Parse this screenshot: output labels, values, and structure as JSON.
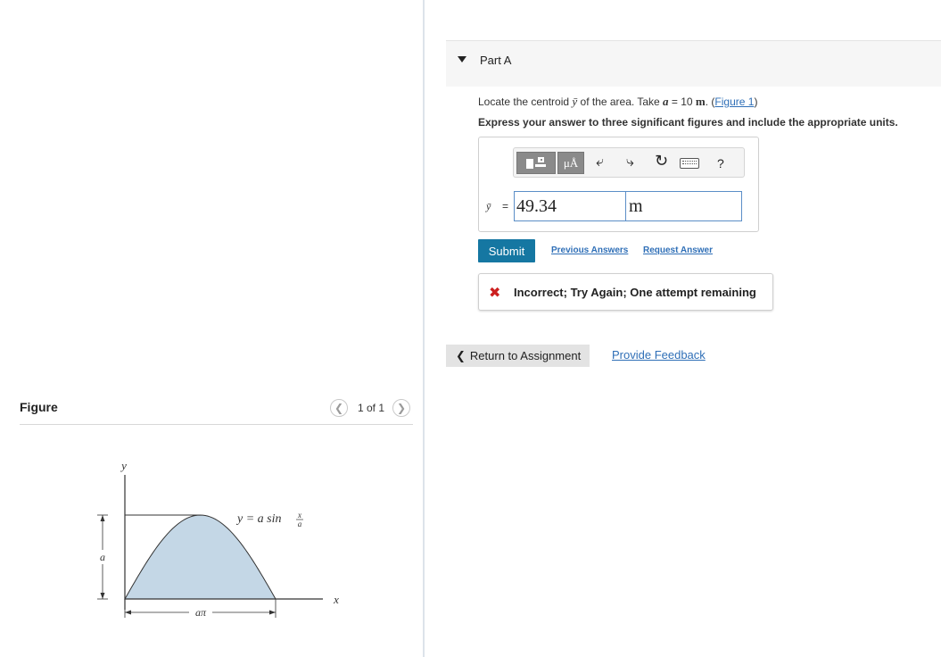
{
  "figure": {
    "title": "Figure",
    "pager": {
      "prev_icon": "chevron-left-icon",
      "text": "1 of 1",
      "next_icon": "chevron-right-icon"
    },
    "diagram": {
      "y_axis_label": "y",
      "x_axis_label": "x",
      "curve_label_prefix": "y = a sin",
      "curve_label_num": "x",
      "curve_label_den": "a",
      "height_label": "a",
      "width_label": "aπ",
      "fill_color": "#c4d7e6"
    }
  },
  "part": {
    "caret_icon": "triangle-down-icon",
    "title": "Part A"
  },
  "question": {
    "prefix": "Locate the centroid ",
    "var": "ȳ",
    "middle": " of the area. Take ",
    "param": "a",
    "equals": " = 10 ",
    "unit": "m",
    "period": ". (",
    "link": "Figure 1",
    "close": ")"
  },
  "instructions": "Express your answer to three significant figures and include the appropriate units.",
  "toolbar": {
    "template_icon": "template-icon",
    "units_label": "μÅ",
    "undo_icon": "undo-icon",
    "redo_icon": "redo-icon",
    "reset_icon": "reset-icon",
    "keyboard_icon": "keyboard-icon",
    "help_label": "?"
  },
  "answer": {
    "variable": "ȳ",
    "equals": "=",
    "value": "49.34",
    "unit": "m"
  },
  "actions": {
    "submit": "Submit",
    "previous_answers": "Previous Answers",
    "request_answer": "Request Answer"
  },
  "feedback": {
    "icon": "x-icon",
    "text": "Incorrect; Try Again; One attempt remaining",
    "color": "#cc1f1f"
  },
  "footer": {
    "return_label": "Return to Assignment",
    "provide_feedback": "Provide Feedback"
  },
  "colors": {
    "accent": "#1577a2",
    "link": "#2f6fb7",
    "input_border": "#5b8ec7"
  }
}
